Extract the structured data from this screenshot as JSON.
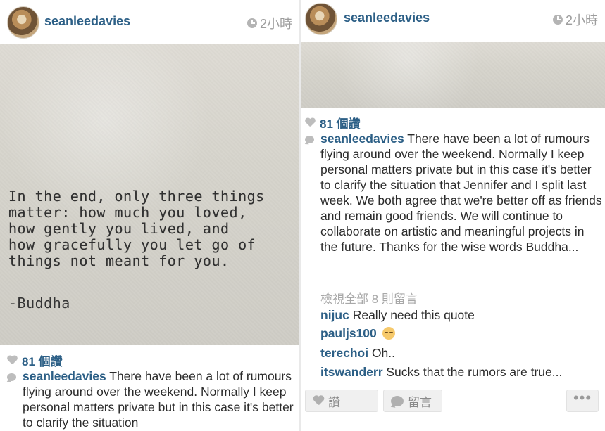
{
  "left_post": {
    "username": "seanleedavies",
    "time": "2小時",
    "quote_lines": "In the end, only three things\nmatter: how much you loved,\nhow gently you lived, and\nhow gracefully you let go of\nthings not meant for you.",
    "quote_attribution": "-Buddha",
    "likes": "81 個讚",
    "caption_user": "seanleedavies",
    "caption_text": " There have been a lot of rumours flying around over the weekend. Normally I keep personal matters private but in this case it's better to clarify the situation"
  },
  "right_post": {
    "username": "seanleedavies",
    "time": "2小時",
    "likes": "81 個讚",
    "caption_user": "seanleedavies",
    "caption_text": " There have been a lot of rumours flying around over the weekend. Normally I keep personal matters private but in this case it's better to clarify the situation that Jennifer and I split last week. We both agree that we're better off as friends and remain good friends. We will continue to collaborate on artistic and meaningful projects in the future. Thanks for the wise words Buddha...",
    "view_all_comments": "檢視全部 8 則留言",
    "comments": [
      {
        "user": "nijuc",
        "text": " Really need this  quote"
      },
      {
        "user": "pauljs100",
        "text": " "
      },
      {
        "user": "terechoi",
        "text": " Oh.."
      },
      {
        "user": "itswanderr",
        "text": " Sucks that the rumors are true..."
      }
    ],
    "actions": {
      "like_label": "讚",
      "comment_label": "留言",
      "more_label": "•••"
    }
  },
  "colors": {
    "username": "#2c5f86",
    "muted": "#a8a8a8",
    "background": "#e9e9e9"
  }
}
